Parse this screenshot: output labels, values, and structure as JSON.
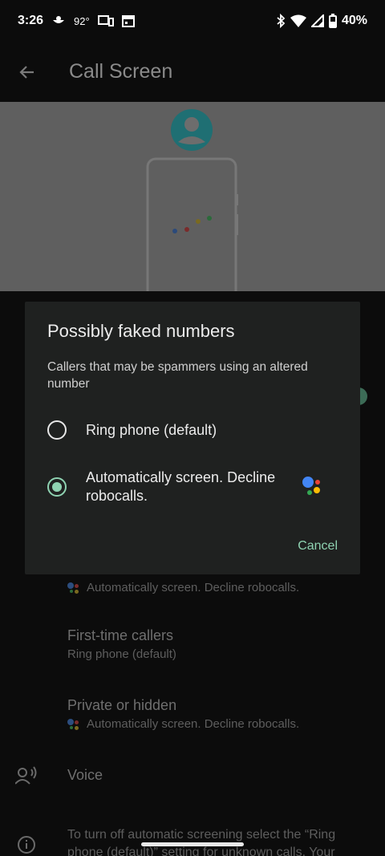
{
  "status_bar": {
    "time": "3:26",
    "temperature": "92°",
    "battery": "40%",
    "icons": [
      "weather-icon",
      "device-icon",
      "calendar-icon",
      "bluetooth-icon",
      "wifi-icon",
      "signal-icon",
      "battery-icon"
    ]
  },
  "app_bar": {
    "title": "Call Screen",
    "back_icon": "arrow-back-icon"
  },
  "colors": {
    "accent": "#8fd3b2",
    "dialog_bg": "#1f2120",
    "scrim": "#0c0c0c",
    "google_blue": "#4285f4",
    "google_red": "#ea4335",
    "google_yellow": "#fbbc05",
    "google_green": "#34a853"
  },
  "dialog": {
    "title": "Possibly faked numbers",
    "description": "Callers that may be spammers using an altered number",
    "options": [
      {
        "label": "Ring phone (default)",
        "selected": false
      },
      {
        "label": "Automatically screen. Decline robocalls.",
        "selected": true,
        "icon": "google-assistant-icon"
      }
    ],
    "cancel_label": "Cancel"
  },
  "background_list": {
    "partial_item_subtitle": "Automatically screen. Decline robocalls.",
    "items": [
      {
        "title": "First-time callers",
        "subtitle": "Ring phone (default)"
      },
      {
        "title": "Private or hidden",
        "subtitle": "Automatically screen. Decline robocalls."
      },
      {
        "title": "Voice",
        "icon": "voice-selection-icon"
      }
    ],
    "footer_text_line1": "To turn off automatic screening select the “Ring",
    "footer_text_line2": "phone (default)” setting for unknown calls. Your",
    "footer_icon": "info-icon"
  }
}
